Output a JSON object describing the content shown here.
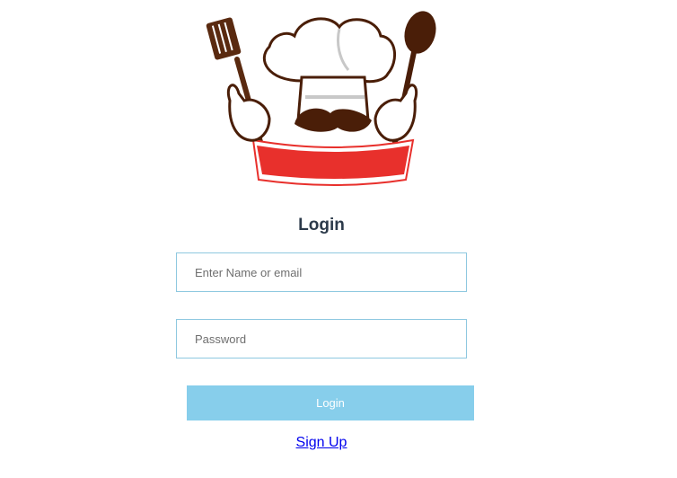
{
  "logo": {
    "icon": "chef-logo-icon"
  },
  "form": {
    "title": "Login",
    "name_placeholder": "Enter Name or email",
    "password_placeholder": "Password",
    "login_label": "Login",
    "signup_label": "Sign Up"
  },
  "colors": {
    "button": "#87ceeb",
    "input_border": "#8ec8e0",
    "title": "#2c3a4a",
    "link": "#0000ee",
    "banner": "#e8302c",
    "outline": "#5a2a10"
  }
}
